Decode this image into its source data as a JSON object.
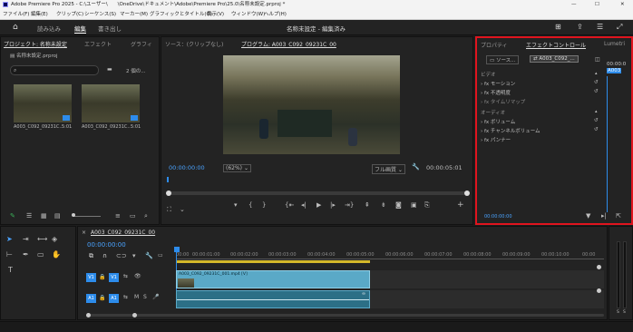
{
  "app": {
    "title": "Adobe Premiere Pro 2025 - C:\\ユーザー\\　　\\OneDrive\\ドキュメント\\Adobe\\Premiere Pro\\25.0\\名称未設定.prproj *",
    "min": "—",
    "max": "☐",
    "close": "✕"
  },
  "menu": [
    "ファイル(F)",
    "編集(E)",
    "クリップ(C)",
    "シーケンス(S)",
    "マーカー(M)",
    "グラフィックとタイトル(G)",
    "表示(V)",
    "ウィンドウ(W)",
    "ヘルプ(H)"
  ],
  "workspace": {
    "tabs": [
      "読み込み",
      "編集",
      "書き出し"
    ],
    "active": "編集",
    "doc_title": "名称未設定 - 編集済み"
  },
  "project": {
    "tabs": [
      "プロジェクト: 名称未設定",
      "エフェクト",
      "グラフィ"
    ],
    "file": "名称未設定.prproj",
    "count": "2 個の...",
    "clips": [
      {
        "name": "A003_C092_09231C...",
        "dur": "5:01"
      },
      {
        "name": "A003_C092_09231C...",
        "dur": "5:01"
      }
    ]
  },
  "source": {
    "tabs": [
      "ソース：(クリップなし)",
      "プログラム: A003_C092_09231C_00"
    ],
    "timecode": "00:00:00:00",
    "zoom": "(62%)",
    "quality": "フル画質",
    "duration": "00:00:05:01"
  },
  "effect_controls": {
    "tabs": [
      "プロパティ",
      "エフェクトコントロール",
      "Lumetri"
    ],
    "source_btn": "ソース...",
    "clip_btn": "A003_C092_...",
    "clip_short": "A003",
    "timecode_right": "00:00:0",
    "video_header": "ビデオ",
    "video_items": [
      "モーション",
      "不透明度",
      "タイムリマップ"
    ],
    "audio_header": "オーディオ",
    "audio_items": [
      "ボリューム",
      "チャンネルボリューム",
      "パンナー"
    ],
    "timecode": "00:00:00:00"
  },
  "timeline": {
    "seq_name": "A003_C092_09231C_00",
    "timecode": "00:00:00:00",
    "ruler": [
      "00:00",
      "00:00:01:00",
      "00:00:02:00",
      "00:00:03:00",
      "00:00:04:00",
      "00:00:05:00",
      "00:00:06:00",
      "00:00:07:00",
      "00:00:08:00",
      "00:00:09:00",
      "00:00:10:00",
      "00:00"
    ],
    "v1_clip": "A003_C092_09231C_001.mp4 [V]",
    "tracks": {
      "v1": "V1",
      "a1": "A1"
    }
  },
  "meter": {
    "labels": [
      "S",
      "S"
    ]
  },
  "colors": {
    "highlight": "#e0141e",
    "accent": "#2d8ceb",
    "clip_video": "#5aa9c7",
    "clip_audio": "#2c6f86"
  }
}
